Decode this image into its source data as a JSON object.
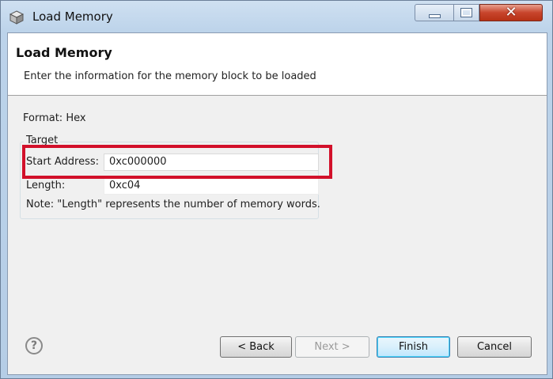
{
  "window": {
    "title": "Load Memory",
    "app_icon": "cube-icon",
    "controls": {
      "minimize": "minimize-icon",
      "maximize": "maximize-icon",
      "close": "close-icon"
    }
  },
  "banner": {
    "title": "Load Memory",
    "description": "Enter the information for the memory block to be loaded"
  },
  "form": {
    "format_label": "Format: Hex",
    "group_label": "Target",
    "start_address": {
      "label": "Start Address:",
      "value": "0xc000000"
    },
    "length": {
      "label": "Length:",
      "value": "0xc04"
    },
    "note": "Note: \"Length\" represents the number of memory words."
  },
  "buttons": {
    "help": "?",
    "back": "< Back",
    "next": "Next >",
    "finish": "Finish",
    "cancel": "Cancel"
  },
  "colors": {
    "highlight": "#d2102a",
    "close_button": "#c8452c"
  }
}
